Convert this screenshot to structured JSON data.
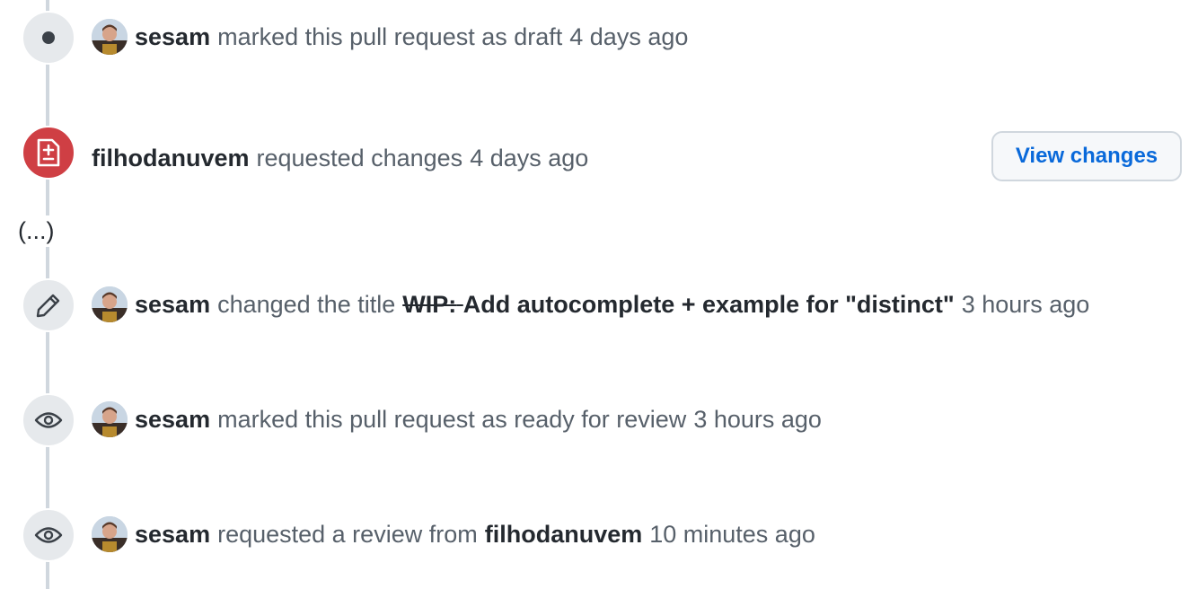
{
  "events": [
    {
      "icon": "dot-icon",
      "actor": "sesam",
      "text": "marked this pull request as draft",
      "time": "4 days ago"
    },
    {
      "icon": "file-diff-icon",
      "actor": "filhodanuvem",
      "text": "requested changes",
      "time": "4 days ago",
      "button": "View changes"
    },
    {
      "icon": "pencil-icon",
      "actor": "sesam",
      "text": "changed the title",
      "old_title": "WIP:",
      "new_title": "Add autocomplete + example for \"distinct\"",
      "time": "3 hours ago"
    },
    {
      "icon": "eye-icon",
      "actor": "sesam",
      "text": "marked this pull request as ready for review",
      "time": "3 hours ago"
    },
    {
      "icon": "eye-icon",
      "actor": "sesam",
      "text": "requested a review from",
      "target": "filhodanuvem",
      "time": "10 minutes ago"
    }
  ],
  "ellipsis": "(...)",
  "colors": {
    "badge_gray": "#e6e9ec",
    "badge_red": "#cf3f44",
    "link_blue": "#0969da",
    "muted_text": "#57606a"
  }
}
